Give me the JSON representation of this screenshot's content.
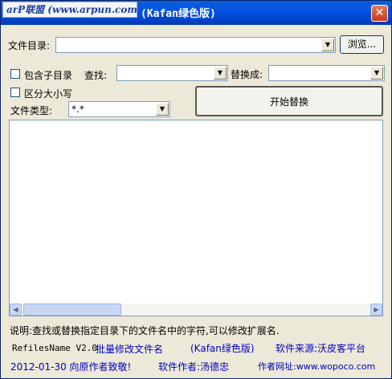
{
  "window": {
    "logo_text": "arP联盟 (www.arpun.com)",
    "title": "(Kafan绿色版)",
    "close_glyph": "✕"
  },
  "form": {
    "dir_label": "文件目录:",
    "dir_value": "",
    "browse_label": "浏览...",
    "include_subdirs_label": "包含子目录",
    "include_subdirs_checked": false,
    "find_label": "查找:",
    "find_value": "",
    "replace_label": "替换成:",
    "replace_value": "",
    "case_label": "区分大小写",
    "case_checked": false,
    "type_label": "文件类型:",
    "type_value": "*.*",
    "start_label": "开始替换"
  },
  "results": {
    "rows": []
  },
  "footer": {
    "description": "说明:查找或替换指定目录下的文件名中的字符,可以修改扩展名.",
    "app_name": "RefilesName V2.0",
    "app_desc": "批量修改文件名",
    "edition": "(Kafan绿色版)",
    "source": "软件来源:沃皮客平台",
    "date": "2012-01-30 向原作者致敬!",
    "author": "软件作者:汤德忠",
    "website": "作者网址:www.wopoco.com"
  },
  "icons": {
    "dropdown": "dropdown-arrow-icon",
    "close": "close-icon",
    "scroll_left": "scroll-left-icon",
    "scroll_right": "scroll-right-icon"
  },
  "colors": {
    "titlebar": "#0054e3",
    "window_bg": "#ece9d8",
    "close_btn": "#c53a1c",
    "footer_blue": "#0000c0"
  }
}
